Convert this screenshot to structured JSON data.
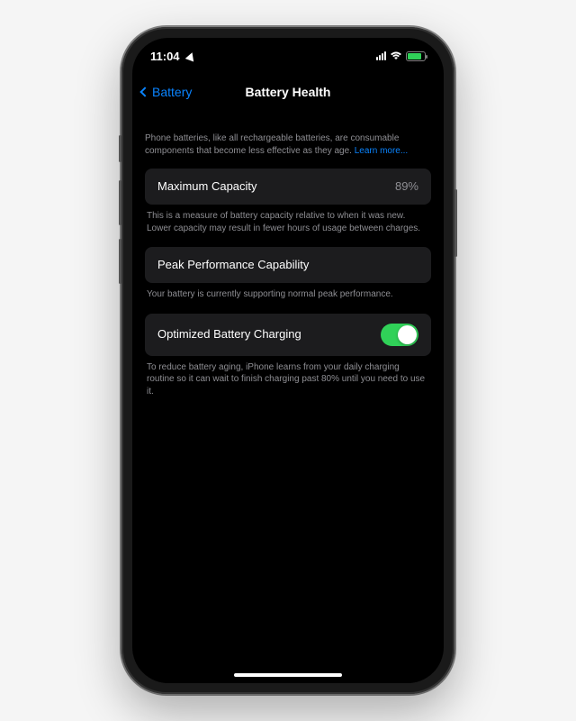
{
  "status_bar": {
    "time": "11:04"
  },
  "nav": {
    "back_label": "Battery",
    "title": "Battery Health"
  },
  "intro": {
    "text": "Phone batteries, like all rechargeable batteries, are consumable components that become less effective as they age. ",
    "learn_more": "Learn more..."
  },
  "max_capacity": {
    "label": "Maximum Capacity",
    "value": "89%",
    "desc": "This is a measure of battery capacity relative to when it was new. Lower capacity may result in fewer hours of usage between charges."
  },
  "peak_perf": {
    "label": "Peak Performance Capability",
    "desc": "Your battery is currently supporting normal peak performance."
  },
  "optimized": {
    "label": "Optimized Battery Charging",
    "enabled": true,
    "desc": "To reduce battery aging, iPhone learns from your daily charging routine so it can wait to finish charging past 80% until you need to use it."
  },
  "colors": {
    "accent": "#0a84ff",
    "toggle_on": "#30d158"
  }
}
